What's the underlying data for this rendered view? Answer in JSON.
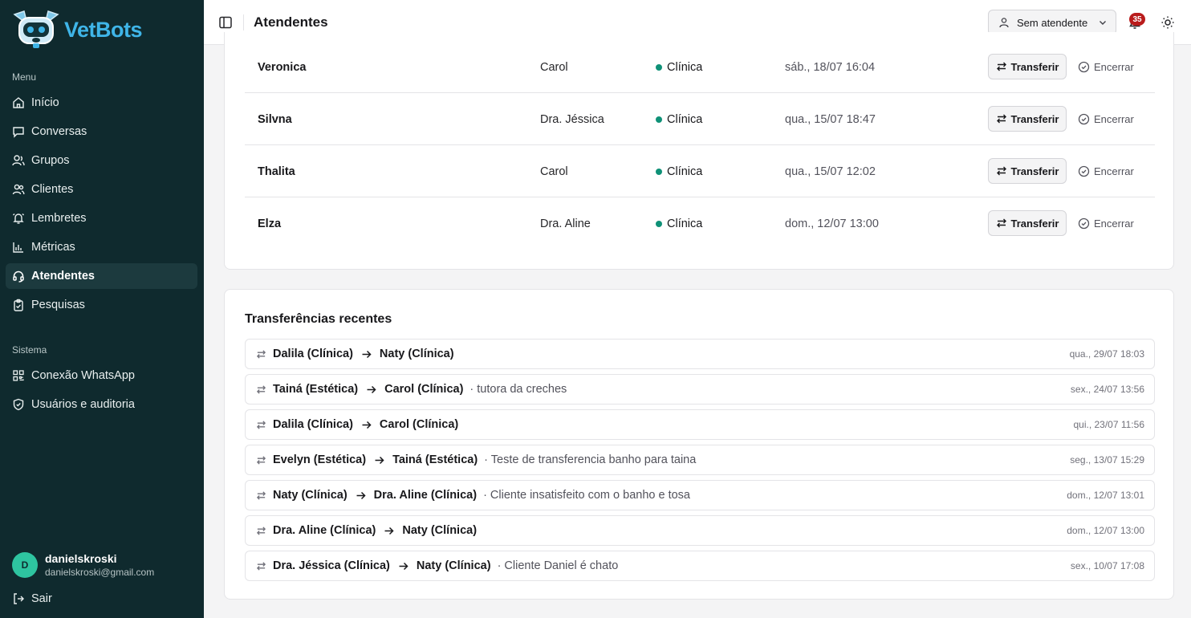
{
  "app": {
    "name": "VetBots"
  },
  "sidebar": {
    "menu_label": "Menu",
    "menu": [
      {
        "label": "Início",
        "icon": "home-icon"
      },
      {
        "label": "Conversas",
        "icon": "chat-icon"
      },
      {
        "label": "Grupos",
        "icon": "group-icon"
      },
      {
        "label": "Clientes",
        "icon": "users-icon"
      },
      {
        "label": "Lembretes",
        "icon": "bell-icon"
      },
      {
        "label": "Métricas",
        "icon": "chart-icon"
      },
      {
        "label": "Atendentes",
        "icon": "headset-icon",
        "active": true
      },
      {
        "label": "Pesquisas",
        "icon": "clipboard-icon"
      }
    ],
    "system_label": "Sistema",
    "system": [
      {
        "label": "Conexão WhatsApp",
        "icon": "qr-icon"
      },
      {
        "label": "Usuários e auditoria",
        "icon": "shield-icon"
      }
    ],
    "user": {
      "initial": "D",
      "name": "danielskroski",
      "email": "danielskroski@gmail.com"
    },
    "logout_label": "Sair"
  },
  "header": {
    "title": "Atendentes",
    "select_value": "Sem atendente",
    "notification_count": "35"
  },
  "attendances": {
    "transfer_label": "Transferir",
    "end_label": "Encerrar",
    "rows": [
      {
        "client": "Veronica",
        "attendant": "Carol",
        "sector": "Clínica",
        "date": "sáb., 18/07 16:04"
      },
      {
        "client": "Silvna",
        "attendant": "Dra. Jéssica",
        "sector": "Clínica",
        "date": "qua., 15/07 18:47"
      },
      {
        "client": "Thalita",
        "attendant": "Carol",
        "sector": "Clínica",
        "date": "qua., 15/07 12:02"
      },
      {
        "client": "Elza",
        "attendant": "Dra. Aline",
        "sector": "Clínica",
        "date": "dom., 12/07 13:00"
      }
    ]
  },
  "transfers": {
    "title": "Transferências recentes",
    "items": [
      {
        "from": "Dalila (Clínica)",
        "to": "Naty (Clínica)",
        "note": "",
        "date": "qua., 29/07 18:03"
      },
      {
        "from": "Tainá (Estética)",
        "to": "Carol (Clínica)",
        "note": "· tutora da creches",
        "date": "sex., 24/07 13:56"
      },
      {
        "from": "Dalila (Clínica)",
        "to": "Carol (Clínica)",
        "note": "",
        "date": "qui., 23/07 11:56"
      },
      {
        "from": "Evelyn (Estética)",
        "to": "Tainá (Estética)",
        "note": "· Teste de transferencia banho para taina",
        "date": "seg., 13/07 15:29"
      },
      {
        "from": "Naty (Clínica)",
        "to": "Dra. Aline (Clínica)",
        "note": "· Cliente insatisfeito com o banho e tosa",
        "date": "dom., 12/07 13:01"
      },
      {
        "from": "Dra. Aline (Clínica)",
        "to": "Naty (Clínica)",
        "note": "",
        "date": "dom., 12/07 13:00"
      },
      {
        "from": "Dra. Jéssica (Clínica)",
        "to": "Naty (Clínica)",
        "note": "· Cliente Daniel é chato",
        "date": "sex., 10/07 17:08"
      }
    ]
  },
  "colors": {
    "sidebar_bg": "#0f2a2e",
    "accent": "#3fb5e8",
    "status_dot": "#0f9177",
    "badge": "#b91c1c"
  }
}
